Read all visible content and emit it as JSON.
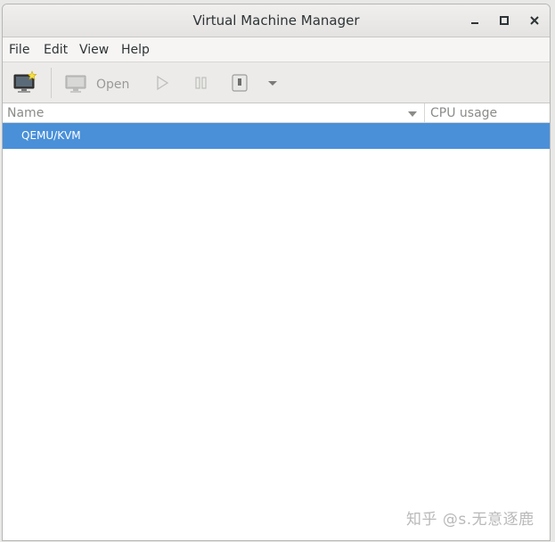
{
  "window": {
    "title": "Virtual Machine Manager"
  },
  "menu": {
    "items": [
      "File",
      "Edit",
      "View",
      "Help"
    ]
  },
  "toolbar": {
    "open_label": "Open"
  },
  "columns": {
    "name": "Name",
    "cpu_usage": "CPU usage"
  },
  "connections": [
    {
      "name": "QEMU/KVM",
      "selected": true
    }
  ],
  "watermark": "知乎 @s.无意逐鹿",
  "colors": {
    "selection": "#4a90d9",
    "window_bg": "#f6f5f4"
  }
}
